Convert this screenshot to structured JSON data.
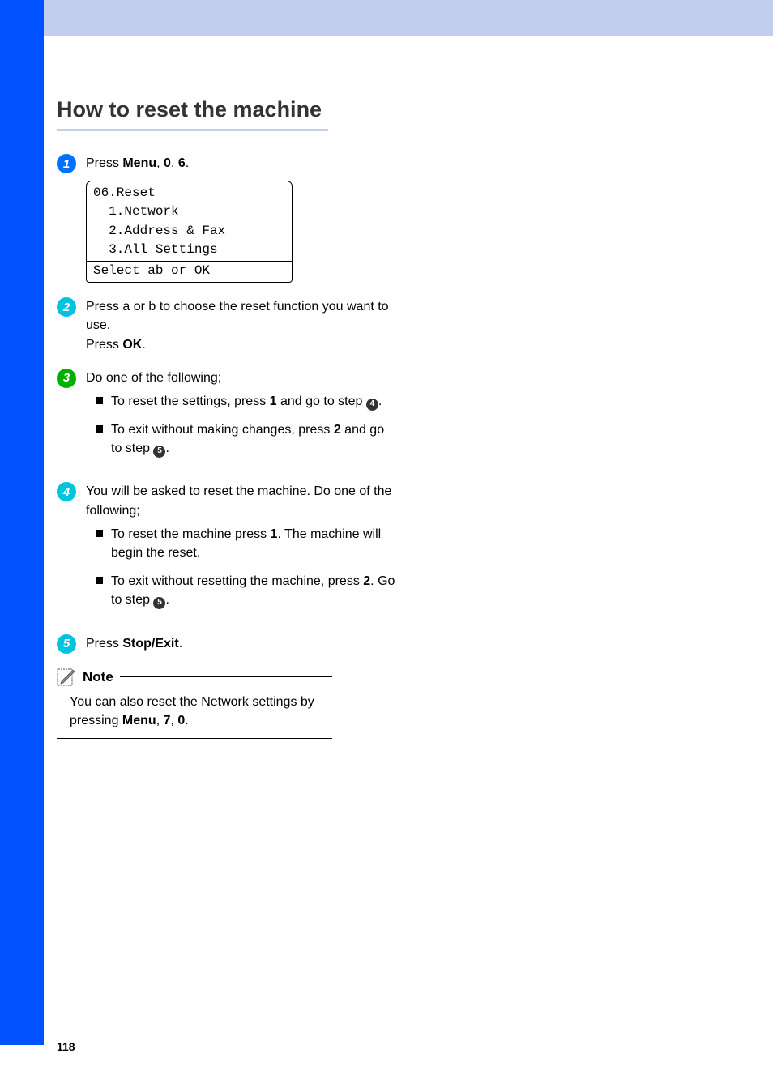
{
  "title": "How to reset the machine",
  "step1": {
    "text_parts": {
      "pre": "Press ",
      "b1": "Menu",
      "c1": ", ",
      "b2": "0",
      "c2": ", ",
      "b3": "6",
      "end": "."
    },
    "lcd": {
      "line1": "06.Reset",
      "line2": "  1.Network",
      "line3": "  2.Address & Fax",
      "line4": "  3.All Settings",
      "line5": "Select ab or OK"
    }
  },
  "step2": {
    "line1a": "Press ",
    "line1b": " or ",
    "line1c": " to choose the reset function you want to use.",
    "line2a": "Press ",
    "line2b": "OK",
    "line2c": "."
  },
  "step3": {
    "intro": "Do one of the following;",
    "bullet1": {
      "pre": "To reset the settings, press ",
      "b": "1",
      "post": " and go to step ",
      "ref": "4",
      "end": "."
    },
    "bullet2": {
      "pre": "To exit without making changes, press ",
      "b": "2",
      "post": " and go to step ",
      "ref": "5",
      "end": "."
    }
  },
  "step4": {
    "intro": "You will be asked to reset the machine. Do one of the following;",
    "bullet1": {
      "pre": "To reset the machine press ",
      "b": "1",
      "post": ". The machine will begin the reset."
    },
    "bullet2": {
      "pre": "To exit without resetting the machine, press ",
      "b": "2",
      "post": ". Go to step ",
      "ref": "5",
      "end": "."
    }
  },
  "step5": {
    "pre": "Press ",
    "b": "Stop/Exit",
    "end": "."
  },
  "note": {
    "label": "Note",
    "body_pre": "You can also reset the Network settings by pressing ",
    "b1": "Menu",
    "c1": ", ",
    "b2": "7",
    "c2": ", ",
    "b3": "0",
    "end": "."
  },
  "page_number": "118"
}
